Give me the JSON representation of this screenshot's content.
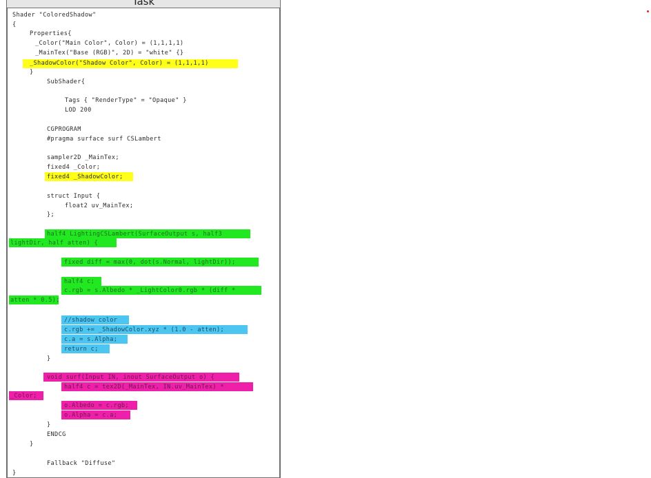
{
  "panel": {
    "title": "Task"
  },
  "code": [
    "Shader \"ColoredShadow\"",
    "{",
    "Properties{",
    "_Color(\"Main Color\", Color) = (1,1,1,1)",
    "_MainTex(\"Base (RGB)\", 2D) = \"white\" {}",
    "_ShadowColor(\"Shadow Color\", Color) = (1,1,1,1)",
    "}",
    "SubShader{",
    "Tags { \"RenderType\" = \"Opaque\" }",
    "LOD 200",
    "CGPROGRAM",
    "#pragma surface surf CSLambert",
    "sampler2D _MainTex;",
    "fixed4 _Color;",
    "fixed4 _ShadowColor;",
    "struct Input {",
    "float2 uv_MainTex;",
    "};",
    "half4 LightingCSLambert(SurfaceOutput s, half3",
    "lightDir, half atten) {",
    "fixed diff = max(0, dot(s.Normal, lightDir));",
    "half4 c;",
    "c.rgb = s.Albedo * _LightColor0.rgb * (diff *",
    "atten * 0.5);",
    "//shadow color",
    "c.rgb += _ShadowColor.xyz * (1.0 - atten);",
    "c.a = s.Alpha;",
    "return c;",
    "}",
    "void surf(Input IN, inout SurfaceOutput o) {",
    "half4 c = tex2D(_MainTex, IN.uv_MainTex) *",
    "_Color;",
    "o.Albedo = c.rgb;",
    "o.Alpha = c.a;",
    "}",
    "ENDCG",
    "}",
    "Fallback \"Diffuse\"",
    "}"
  ],
  "highlight_colors": {
    "yellow": "#ffff1a",
    "green": "#22e822",
    "blue": "#4cc6f0",
    "magenta": "#ee1fa8"
  },
  "marker_color": "#e82020"
}
